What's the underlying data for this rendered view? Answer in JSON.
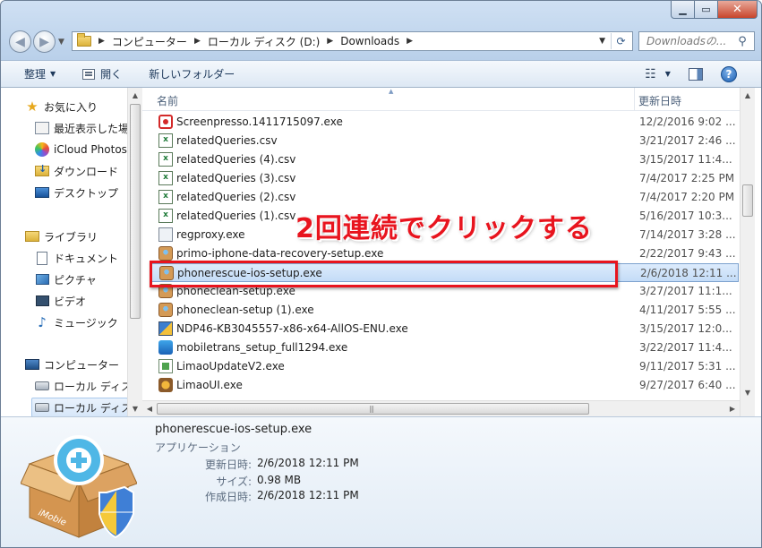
{
  "address": {
    "crumbs": [
      "コンピューター",
      "ローカル ディスク (D:)",
      "Downloads"
    ]
  },
  "search": {
    "placeholder": "Downloadsの..."
  },
  "toolbar": {
    "organize": "整理",
    "open": "開く",
    "new_folder": "新しいフォルダー"
  },
  "nav": {
    "favorites": "お気に入り",
    "recent": "最近表示した場",
    "icloud": "iCloud Photos",
    "downloads": "ダウンロード",
    "desktop": "デスクトップ",
    "libraries": "ライブラリ",
    "documents": "ドキュメント",
    "pictures": "ピクチャ",
    "videos": "ビデオ",
    "music": "ミュージック",
    "computer": "コンピューター",
    "local_disk_c": "ローカル ディス",
    "local_disk_d": "ローカル ディス"
  },
  "columns": {
    "name": "名前",
    "date": "更新日時"
  },
  "files": [
    {
      "name": "Screenpresso.1411715097.exe",
      "date": "12/2/2016 9:02 ...",
      "icon": "screenpresso-icon"
    },
    {
      "name": "relatedQueries.csv",
      "date": "3/21/2017 2:46 ...",
      "icon": "csv-icon"
    },
    {
      "name": "relatedQueries (4).csv",
      "date": "3/15/2017 11:4...",
      "icon": "csv-icon"
    },
    {
      "name": "relatedQueries (3).csv",
      "date": "7/4/2017 2:25 PM",
      "icon": "csv-icon"
    },
    {
      "name": "relatedQueries (2).csv",
      "date": "7/4/2017 2:20 PM",
      "icon": "csv-icon"
    },
    {
      "name": "relatedQueries (1).csv",
      "date": "5/16/2017 10:3...",
      "icon": "csv-icon"
    },
    {
      "name": "regproxy.exe",
      "date": "7/14/2017 3:28 ...",
      "icon": "exe-icon"
    },
    {
      "name": "primo-iphone-data-recovery-setup.exe",
      "date": "2/22/2017 9:43 ...",
      "icon": "installer-box-icon"
    },
    {
      "name": "phonerescue-ios-setup.exe",
      "date": "2/6/2018 12:11 ...",
      "icon": "installer-box-icon"
    },
    {
      "name": "phoneclean-setup.exe",
      "date": "3/27/2017 11:1...",
      "icon": "installer-box-icon"
    },
    {
      "name": "phoneclean-setup (1).exe",
      "date": "4/11/2017 5:55 ...",
      "icon": "installer-box-icon"
    },
    {
      "name": "NDP46-KB3045557-x86-x64-AllOS-ENU.exe",
      "date": "3/15/2017 12:0...",
      "icon": "dotnet-installer-icon"
    },
    {
      "name": "mobiletrans_setup_full1294.exe",
      "date": "3/22/2017 11:4...",
      "icon": "mobiletrans-icon"
    },
    {
      "name": "LimaoUpdateV2.exe",
      "date": "9/11/2017 5:31 ...",
      "icon": "limao-icon"
    },
    {
      "name": "LimaoUI.exe",
      "date": "9/27/2017 6:40 ...",
      "icon": "limaoui-icon"
    }
  ],
  "selected_index": 8,
  "annotation": "2回連続でクリックする",
  "details": {
    "name": "phonerescue-ios-setup.exe",
    "type": "アプリケーション",
    "modified_label": "更新日時:",
    "modified_value": "2/6/2018 12:11 PM",
    "size_label": "サイズ:",
    "size_value": "0.98 MB",
    "created_label": "作成日時:",
    "created_value": "2/6/2018 12:11 PM",
    "icon_brand": "iMobie"
  },
  "colors": {
    "annotation": "#e8141e",
    "selection": "#c4dcf7"
  }
}
